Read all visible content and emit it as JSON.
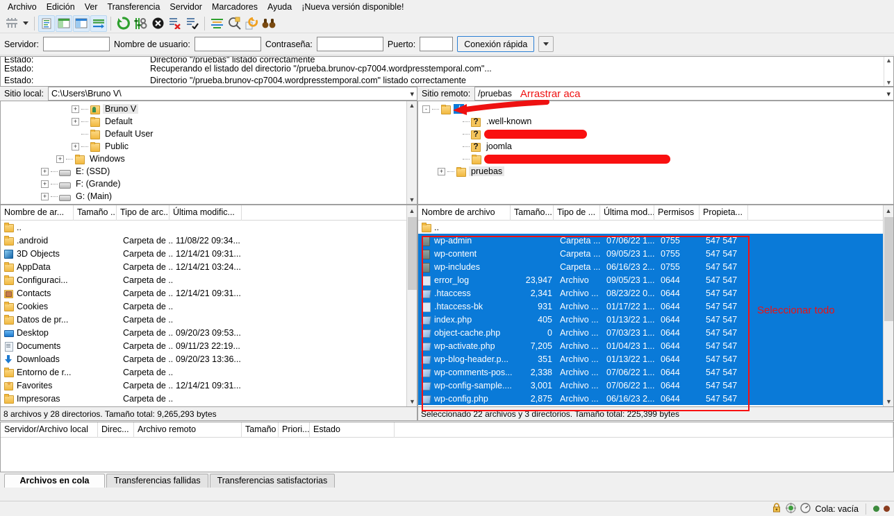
{
  "menu": {
    "items": [
      "Archivo",
      "Edición",
      "Ver",
      "Transferencia",
      "Servidor",
      "Marcadores",
      "Ayuda",
      "¡Nueva versión disponible!"
    ]
  },
  "toolbar": {
    "buttons": [
      {
        "name": "site-manager-icon",
        "glyph": "site-manager"
      },
      {
        "name": "toggle-message-log-icon",
        "glyph": "msglog"
      },
      {
        "name": "toggle-local-tree-icon",
        "glyph": "localtree"
      },
      {
        "name": "toggle-remote-tree-icon",
        "glyph": "remotetree"
      },
      {
        "name": "toggle-transfer-queue-icon",
        "glyph": "queue"
      },
      {
        "name": "refresh-icon",
        "glyph": "refresh"
      },
      {
        "name": "process-queue-icon",
        "glyph": "processqueue"
      },
      {
        "name": "cancel-icon",
        "glyph": "cancel"
      },
      {
        "name": "disconnect-icon",
        "glyph": "disconnect"
      },
      {
        "name": "reconnect-icon",
        "glyph": "reconnect"
      },
      {
        "name": "filter-icon",
        "glyph": "filter"
      },
      {
        "name": "compare-directories-icon",
        "glyph": "compare"
      },
      {
        "name": "synchronized-browsing-icon",
        "glyph": "sync"
      },
      {
        "name": "search-remote-files-icon",
        "glyph": "binoculars"
      }
    ]
  },
  "quickconnect": {
    "server_label": "Servidor:",
    "server_value": "",
    "user_label": "Nombre de usuario:",
    "user_value": "",
    "password_label": "Contraseña:",
    "password_value": "",
    "port_label": "Puerto:",
    "port_value": "",
    "connect_button": "Conexión rápida"
  },
  "status_log": {
    "rows": [
      {
        "key": "Estado:",
        "msg": "Directorio \"/pruebas\" listado correctamente"
      },
      {
        "key": "Estado:",
        "msg": "Recuperando el listado del directorio \"/prueba.brunov-cp7004.wordpresstemporal.com\"..."
      },
      {
        "key": "Estado:",
        "msg": "Directorio \"/prueba.brunov-cp7004.wordpresstemporal.com\" listado correctamente"
      }
    ]
  },
  "local": {
    "site_label": "Sitio local:",
    "site_value": "C:\\Users\\Bruno V\\",
    "tree": [
      {
        "label": "Bruno V",
        "icon": "user-folder-icon",
        "indent": 4,
        "expander": "+",
        "selected": true
      },
      {
        "label": "Default",
        "icon": "folder-icon",
        "indent": 4,
        "expander": "+",
        "selected": false
      },
      {
        "label": "Default User",
        "icon": "folder-icon",
        "indent": 4,
        "expander": "",
        "selected": false
      },
      {
        "label": "Public",
        "icon": "folder-icon",
        "indent": 4,
        "expander": "+",
        "selected": false
      },
      {
        "label": "Windows",
        "icon": "folder-icon",
        "indent": 3,
        "expander": "+",
        "selected": false
      },
      {
        "label": "E: (SSD)",
        "icon": "drive-icon",
        "indent": 2,
        "expander": "+",
        "selected": false
      },
      {
        "label": "F: (Grande)",
        "icon": "drive-icon",
        "indent": 2,
        "expander": "+",
        "selected": false
      },
      {
        "label": "G: (Main)",
        "icon": "drive-icon",
        "indent": 2,
        "expander": "+",
        "selected": false
      }
    ],
    "columns": [
      "Nombre de ar...",
      "Tamaño ...",
      "Tipo de arc...",
      "Última modific..."
    ],
    "rows": [
      {
        "name": "..",
        "icon": "folder-icon",
        "size": "",
        "type": "",
        "modified": ""
      },
      {
        "name": ".android",
        "icon": "folder-icon",
        "size": "",
        "type": "Carpeta de ...",
        "modified": "11/08/22 09:34..."
      },
      {
        "name": "3D Objects",
        "icon": "cube-icon",
        "size": "",
        "type": "Carpeta de ...",
        "modified": "12/14/21 09:31..."
      },
      {
        "name": "AppData",
        "icon": "folder-icon",
        "size": "",
        "type": "Carpeta de ...",
        "modified": "12/14/21 03:24..."
      },
      {
        "name": "Configuraci...",
        "icon": "folder-icon",
        "size": "",
        "type": "Carpeta de ...",
        "modified": ""
      },
      {
        "name": "Contacts",
        "icon": "contacts-icon",
        "size": "",
        "type": "Carpeta de ...",
        "modified": "12/14/21 09:31..."
      },
      {
        "name": "Cookies",
        "icon": "folder-icon",
        "size": "",
        "type": "Carpeta de ...",
        "modified": ""
      },
      {
        "name": "Datos de pr...",
        "icon": "folder-icon",
        "size": "",
        "type": "Carpeta de ...",
        "modified": ""
      },
      {
        "name": "Desktop",
        "icon": "desktop-icon",
        "size": "",
        "type": "Carpeta de ...",
        "modified": "09/20/23 09:53..."
      },
      {
        "name": "Documents",
        "icon": "documents-icon",
        "size": "",
        "type": "Carpeta de ...",
        "modified": "09/11/23 22:19..."
      },
      {
        "name": "Downloads",
        "icon": "downloads-icon",
        "size": "",
        "type": "Carpeta de ...",
        "modified": "09/20/23 13:36..."
      },
      {
        "name": "Entorno de r...",
        "icon": "folder-icon",
        "size": "",
        "type": "Carpeta de ...",
        "modified": ""
      },
      {
        "name": "Favorites",
        "icon": "favorites-icon",
        "size": "",
        "type": "Carpeta de ...",
        "modified": "12/14/21 09:31..."
      },
      {
        "name": "Impresoras",
        "icon": "folder-icon",
        "size": "",
        "type": "Carpeta de ...",
        "modified": ""
      }
    ],
    "status": "8 archivos y 28 directorios. Tamaño total: 9,265,293 bytes"
  },
  "remote": {
    "site_label": "Sitio remoto:",
    "site_value": "/pruebas",
    "annotation_drag": "Arrastrar aca",
    "annotation_select": "Seleccionar todo",
    "tree": [
      {
        "label": "/",
        "icon": "folder-icon",
        "indent": 0,
        "expander": "-",
        "selected": true,
        "redacted": false
      },
      {
        "label": ".well-known",
        "icon": "question-folder-icon",
        "indent": 2,
        "expander": "",
        "selected": false,
        "redacted": false
      },
      {
        "label": "",
        "icon": "question-folder-icon",
        "indent": 2,
        "expander": "",
        "selected": false,
        "redacted": true,
        "redact_width": 148
      },
      {
        "label": "joomla",
        "icon": "question-folder-icon",
        "indent": 2,
        "expander": "",
        "selected": false,
        "redacted": false
      },
      {
        "label": "",
        "icon": "folder-icon",
        "indent": 2,
        "expander": "",
        "selected": false,
        "redacted": true,
        "redact_width": 268
      },
      {
        "label": "pruebas",
        "icon": "folder-icon",
        "indent": 1,
        "expander": "+",
        "selected": true,
        "redacted": false
      }
    ],
    "columns": [
      "Nombre de archivo",
      "Tamaño...",
      "Tipo de ...",
      "Última mod...",
      "Permisos",
      "Propieta..."
    ],
    "rows": [
      {
        "name": "..",
        "icon": "folder-icon",
        "size": "",
        "type": "",
        "modified": "",
        "perms": "",
        "owner": "",
        "selected": false
      },
      {
        "name": "wp-admin",
        "icon": "remote-folder-icon",
        "size": "",
        "type": "Carpeta ...",
        "modified": "07/06/22 1...",
        "perms": "0755",
        "owner": "547 547",
        "selected": true
      },
      {
        "name": "wp-content",
        "icon": "remote-folder-icon",
        "size": "",
        "type": "Carpeta ...",
        "modified": "09/05/23 1...",
        "perms": "0755",
        "owner": "547 547",
        "selected": true
      },
      {
        "name": "wp-includes",
        "icon": "remote-folder-icon",
        "size": "",
        "type": "Carpeta ...",
        "modified": "06/16/23 2...",
        "perms": "0755",
        "owner": "547 547",
        "selected": true
      },
      {
        "name": "error_log",
        "icon": "file-icon",
        "size": "23,947",
        "type": "Archivo",
        "modified": "09/05/23 1...",
        "perms": "0644",
        "owner": "547 547",
        "selected": true
      },
      {
        "name": ".htaccess",
        "icon": "php-icon",
        "size": "2,341",
        "type": "Archivo ...",
        "modified": "08/23/22 0...",
        "perms": "0644",
        "owner": "547 547",
        "selected": true
      },
      {
        "name": ".htaccess-bk",
        "icon": "file-icon",
        "size": "931",
        "type": "Archivo ...",
        "modified": "01/17/22 1...",
        "perms": "0644",
        "owner": "547 547",
        "selected": true
      },
      {
        "name": "index.php",
        "icon": "php-icon",
        "size": "405",
        "type": "Archivo ...",
        "modified": "01/13/22 1...",
        "perms": "0644",
        "owner": "547 547",
        "selected": true
      },
      {
        "name": "object-cache.php",
        "icon": "php-icon",
        "size": "0",
        "type": "Archivo ...",
        "modified": "07/03/23 1...",
        "perms": "0644",
        "owner": "547 547",
        "selected": true
      },
      {
        "name": "wp-activate.php",
        "icon": "php-icon",
        "size": "7,205",
        "type": "Archivo ...",
        "modified": "01/04/23 1...",
        "perms": "0644",
        "owner": "547 547",
        "selected": true
      },
      {
        "name": "wp-blog-header.p...",
        "icon": "php-icon",
        "size": "351",
        "type": "Archivo ...",
        "modified": "01/13/22 1...",
        "perms": "0644",
        "owner": "547 547",
        "selected": true
      },
      {
        "name": "wp-comments-pos...",
        "icon": "php-icon",
        "size": "2,338",
        "type": "Archivo ...",
        "modified": "07/06/22 1...",
        "perms": "0644",
        "owner": "547 547",
        "selected": true
      },
      {
        "name": "wp-config-sample....",
        "icon": "php-icon",
        "size": "3,001",
        "type": "Archivo ...",
        "modified": "07/06/22 1...",
        "perms": "0644",
        "owner": "547 547",
        "selected": true
      },
      {
        "name": "wp-config.php",
        "icon": "php-icon",
        "size": "2,875",
        "type": "Archivo ...",
        "modified": "06/16/23 2...",
        "perms": "0644",
        "owner": "547 547",
        "selected": true
      }
    ],
    "status": "Seleccionado 22 archivos y 3 directorios. Tamaño total: 225,399 bytes"
  },
  "queue": {
    "columns": [
      "Servidor/Archivo local",
      "Direc...",
      "Archivo remoto",
      "Tamaño",
      "Priori...",
      "Estado"
    ],
    "rows": []
  },
  "tabs": [
    {
      "label": "Archivos en cola",
      "active": true
    },
    {
      "label": "Transferencias fallidas",
      "active": false
    },
    {
      "label": "Transferencias satisfactorias",
      "active": false
    }
  ],
  "bottom_bar": {
    "queue_status": "Cola: vacía",
    "icons": [
      "lock-icon",
      "settings-icon",
      "speed-icon"
    ],
    "leds": [
      "#3c8a3c",
      "#8a3c1e"
    ]
  },
  "colors": {
    "selection_blue": "#0a7ad8",
    "annotation_red": "#ee1111",
    "redaction_red": "#f91010",
    "accent_border": "#2a7fd4"
  }
}
